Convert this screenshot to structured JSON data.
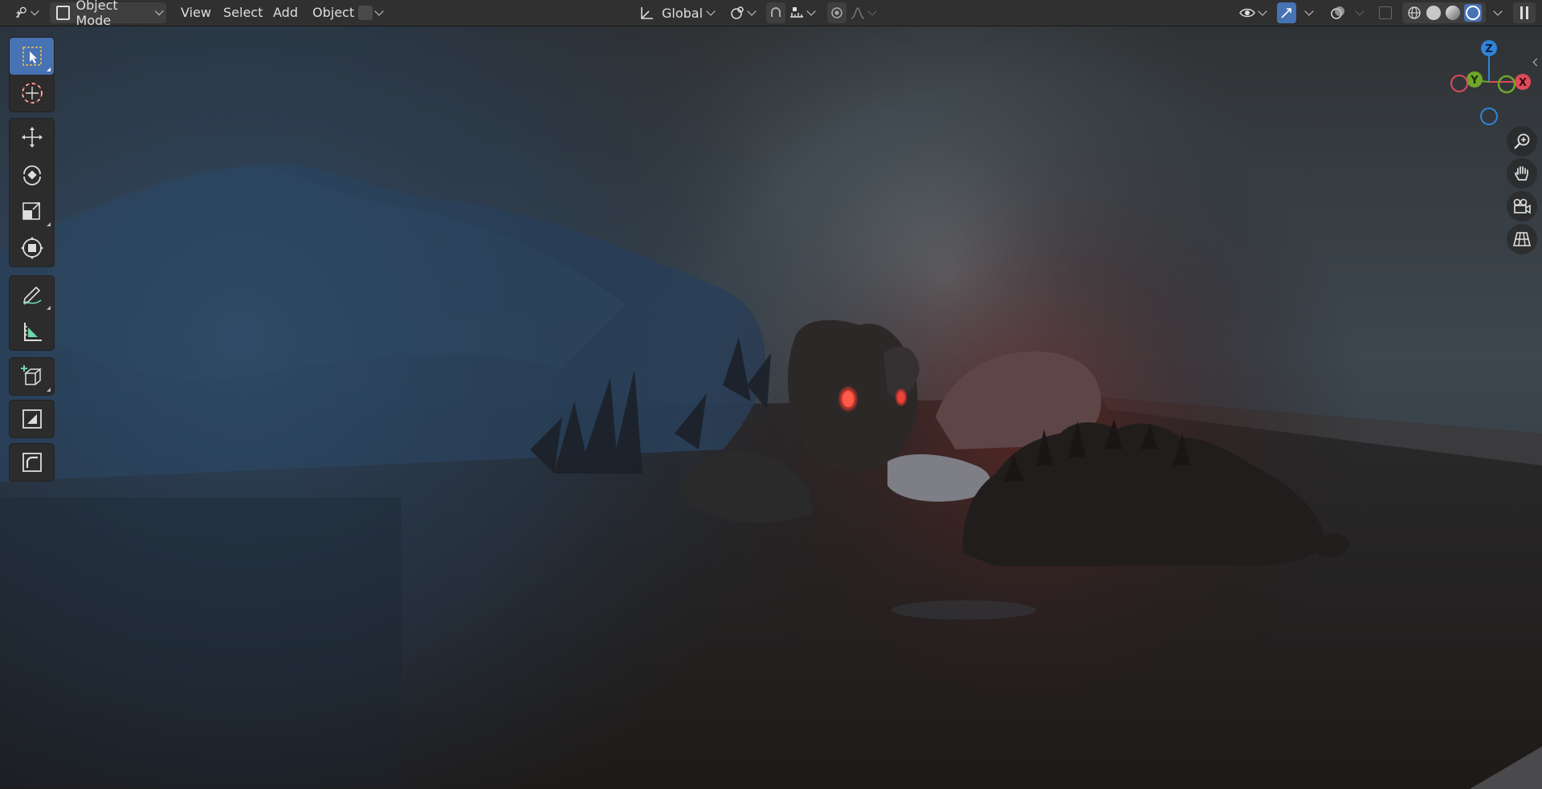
{
  "header": {
    "mode": {
      "label": "Object Mode"
    },
    "menus": [
      "View",
      "Select",
      "Add",
      "Object"
    ],
    "orientation": {
      "label": "Global"
    }
  },
  "toolbar": {
    "tools": [
      "select-box",
      "cursor",
      "move",
      "rotate",
      "scale",
      "transform",
      "annotate",
      "measure",
      "add-cube",
      "inset",
      "bevel"
    ],
    "active_tool": "select-box"
  },
  "gizmo": {
    "axis_z": "Z",
    "axis_y": "Y",
    "axis_x": "X"
  },
  "colors": {
    "accent": "#4772b3",
    "axis_x": "#e04a5a",
    "axis_y": "#6fa52a",
    "axis_z": "#2f84d9",
    "eye_glow": "#ff3b2f"
  },
  "icons": {
    "header_right": [
      "eye-icon",
      "gizmo-toggle-icon",
      "overlay-icon",
      "xray-icon",
      "wireframe-shading-icon",
      "solid-shading-icon",
      "material-shading-icon",
      "rendered-shading-icon"
    ],
    "nav": [
      "zoom-icon",
      "pan-hand-icon",
      "camera-view-icon",
      "grid-ortho-icon"
    ]
  }
}
